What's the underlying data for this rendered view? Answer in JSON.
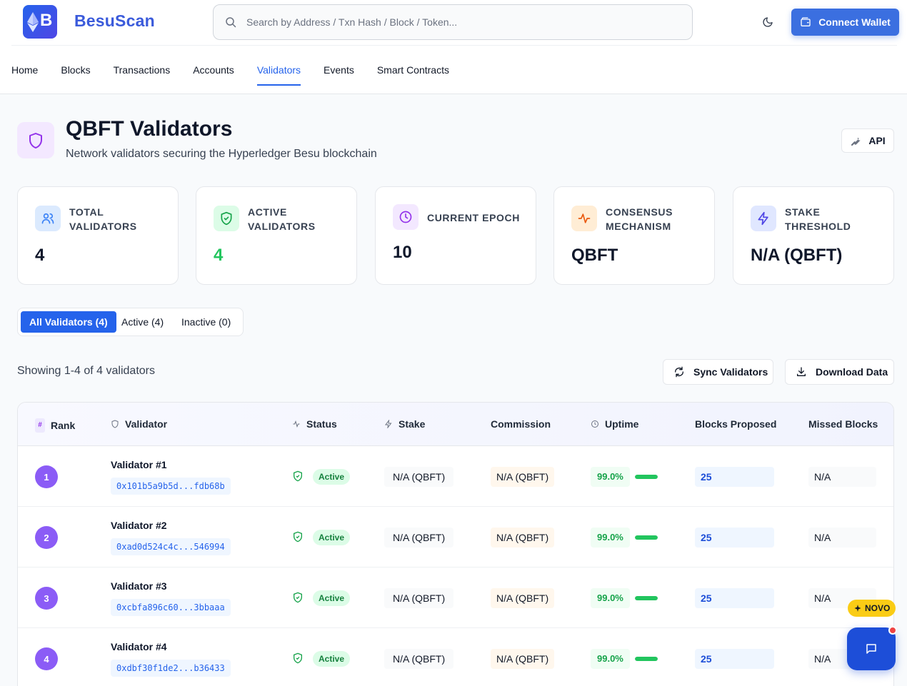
{
  "header": {
    "logo_letter": "B",
    "brand": "BesuScan",
    "search_placeholder": "Search by Address / Txn Hash / Block / Token...",
    "connect_wallet": "Connect Wallet"
  },
  "nav": {
    "items": [
      "Home",
      "Blocks",
      "Transactions",
      "Accounts",
      "Validators",
      "Events",
      "Smart Contracts"
    ],
    "active": "Validators"
  },
  "page": {
    "title": "QBFT Validators",
    "subtitle": "Network validators securing the Hyperledger Besu blockchain",
    "api_label": "API"
  },
  "stats": [
    {
      "label": "Total Validators",
      "value": "4",
      "icon": "users-icon",
      "color": "#3b82f6"
    },
    {
      "label": "Active Validators",
      "value": "4",
      "icon": "shield-check-icon",
      "color": "#22c55e"
    },
    {
      "label": "Current Epoch",
      "value": "10",
      "icon": "clock-icon",
      "color": "#9333ea"
    },
    {
      "label": "Consensus Mechanism",
      "value": "QBFT",
      "icon": "activity-icon",
      "color": "#ea580c"
    },
    {
      "label": "Stake Threshold",
      "value": "N/A (QBFT)",
      "icon": "zap-icon",
      "color": "#4f46e5"
    }
  ],
  "filters": {
    "tabs": [
      "All Validators (4)",
      "Active (4)",
      "Inactive (0)"
    ],
    "active": 0
  },
  "toolbar": {
    "showing": "Showing 1-4 of 4 validators",
    "sync_label": "Sync Validators",
    "download_label": "Download Data"
  },
  "table": {
    "columns": {
      "rank": "Rank",
      "validator": "Validator",
      "status": "Status",
      "stake": "Stake",
      "commission": "Commission",
      "uptime": "Uptime",
      "blocks_proposed": "Blocks Proposed",
      "missed_blocks": "Missed Blocks"
    },
    "rank_badge": "#",
    "rows": [
      {
        "rank": "1",
        "name": "Validator #1",
        "address": "0x101b5a9b5d...fdb68b",
        "status": "Active",
        "stake": "N/A (QBFT)",
        "commission": "N/A (QBFT)",
        "uptime": "99.0%",
        "uptime_fraction": 0.99,
        "blocks": "25",
        "missed": "N/A"
      },
      {
        "rank": "2",
        "name": "Validator #2",
        "address": "0xad0d524c4c...546994",
        "status": "Active",
        "stake": "N/A (QBFT)",
        "commission": "N/A (QBFT)",
        "uptime": "99.0%",
        "uptime_fraction": 0.99,
        "blocks": "25",
        "missed": "N/A"
      },
      {
        "rank": "3",
        "name": "Validator #3",
        "address": "0xcbfa896c60...3bbaaa",
        "status": "Active",
        "stake": "N/A (QBFT)",
        "commission": "N/A (QBFT)",
        "uptime": "99.0%",
        "uptime_fraction": 0.99,
        "blocks": "25",
        "missed": "N/A"
      },
      {
        "rank": "4",
        "name": "Validator #4",
        "address": "0xdbf30f1de2...b36433",
        "status": "Active",
        "stake": "N/A (QBFT)",
        "commission": "N/A (QBFT)",
        "uptime": "99.0%",
        "uptime_fraction": 0.99,
        "blocks": "25",
        "missed": "N/A"
      }
    ]
  },
  "floating": {
    "novo_label": "NOVO"
  },
  "colors": {
    "primary": "#2563eb",
    "rank_badge": "#8b5cf6",
    "active_green": "#22c55e"
  }
}
